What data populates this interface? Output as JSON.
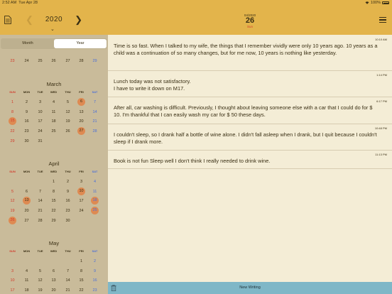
{
  "status_bar": {
    "time": "2:52 AM",
    "date": "Tue Apr 28",
    "battery": "100%"
  },
  "sidebar": {
    "year": "2020",
    "segments": [
      {
        "label": "Month",
        "active": false
      },
      {
        "label": "Year",
        "active": true
      }
    ],
    "weekday_labels": [
      "SUN",
      "MON",
      "TUE",
      "WED",
      "THU",
      "FRI",
      "SAT"
    ],
    "prev_month_tail": {
      "days": [
        "23",
        "24",
        "25",
        "26",
        "27",
        "28",
        "29"
      ],
      "marked": []
    },
    "months": [
      {
        "name": "March",
        "weeks": [
          [
            "1",
            "2",
            "3",
            "4",
            "5",
            "6",
            "7"
          ],
          [
            "8",
            "9",
            "10",
            "11",
            "12",
            "13",
            "14"
          ],
          [
            "15",
            "16",
            "17",
            "18",
            "19",
            "20",
            "21"
          ],
          [
            "22",
            "23",
            "24",
            "25",
            "26",
            "27",
            "28"
          ],
          [
            "29",
            "30",
            "31",
            "",
            "",
            "",
            ""
          ]
        ],
        "marked": [
          "6",
          "15",
          "27"
        ]
      },
      {
        "name": "April",
        "weeks": [
          [
            "",
            "",
            "",
            "1",
            "2",
            "3",
            "4"
          ],
          [
            "5",
            "6",
            "7",
            "8",
            "9",
            "10",
            "11"
          ],
          [
            "12",
            "13",
            "14",
            "15",
            "16",
            "17",
            "18"
          ],
          [
            "19",
            "20",
            "21",
            "22",
            "23",
            "24",
            "25"
          ],
          [
            "26",
            "27",
            "28",
            "29",
            "30",
            "",
            ""
          ]
        ],
        "marked": [
          "10",
          "13",
          "18",
          "25",
          "26"
        ]
      },
      {
        "name": "May",
        "weeks": [
          [
            "",
            "",
            "",
            "",
            "",
            "1",
            "2"
          ],
          [
            "3",
            "4",
            "5",
            "6",
            "7",
            "8",
            "9"
          ],
          [
            "10",
            "11",
            "12",
            "13",
            "14",
            "15",
            "16"
          ],
          [
            "17",
            "18",
            "19",
            "20",
            "21",
            "22",
            "23"
          ]
        ],
        "marked": []
      }
    ]
  },
  "header": {
    "date_small": "04/2020",
    "day": "26",
    "weekday": "Sun"
  },
  "entries": [
    {
      "time": "10:10 AM",
      "text": "Time is so fast. When I talked to my wife, the things that I remember vividly were only 10 years ago. 10 years as a child was a continuation of so many changes, but for me now, 10 years is nothing like yesterday."
    },
    {
      "time": "1:14 PM",
      "text": "Lunch today was not satisfactory.\nI have to write it down on M17."
    },
    {
      "time": "6:17 PM",
      "text": "After all, car washing is difficult. Previously, I thought about leaving someone else with a car that I could do for $ 10. I'm thankful that I can easily wash my car for $ 50 these days."
    },
    {
      "time": "10:48 PM",
      "text": "I couldn't sleep, so I drank half a bottle of wine alone. I didn't fall asleep when I drank, but I quit because I couldn't sleep if I drank more."
    },
    {
      "time": "11:13 PM",
      "text": "Book is not fun Sleep well I don't think I really needed to drink wine."
    }
  ],
  "bottom_bar": {
    "new_writing_label": "New Writing"
  },
  "colors": {
    "header": "#e3b44b",
    "sidebar": "#c9bb9a",
    "marked": "#de8a52",
    "sunday": "#d23a2b",
    "saturday": "#4a6ed8",
    "bottom_bar": "#7fb7c7"
  }
}
